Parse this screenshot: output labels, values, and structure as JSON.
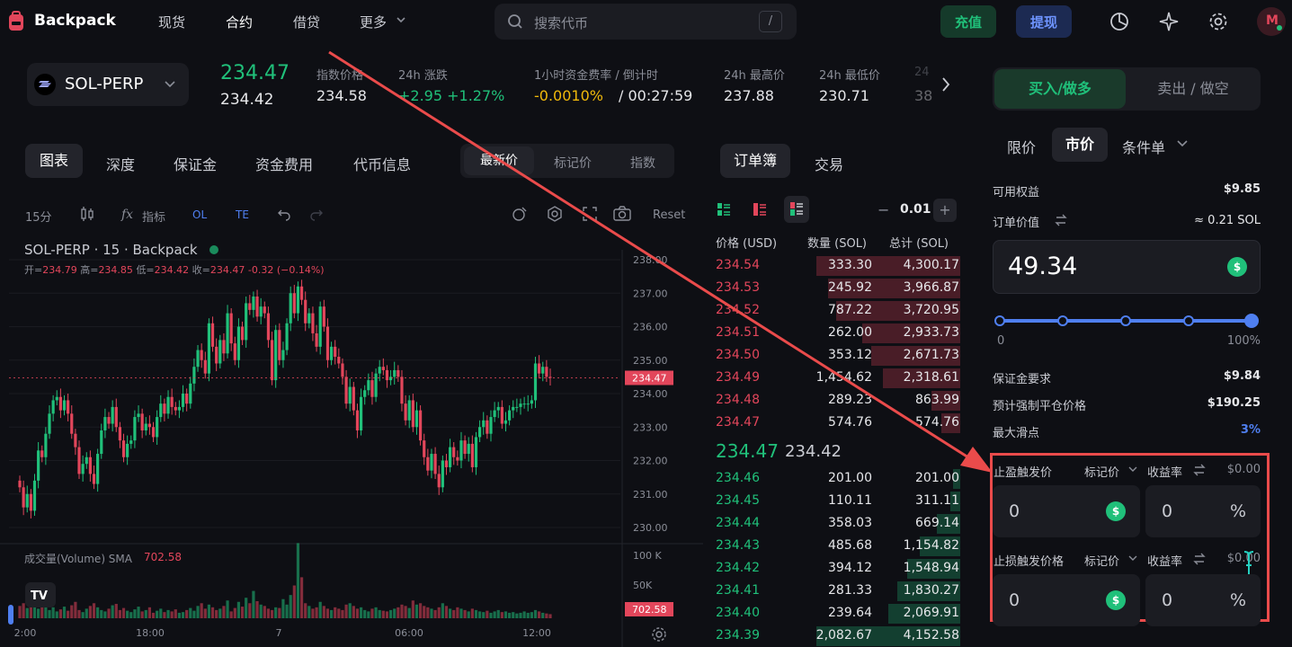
{
  "nav": {
    "brand": "Backpack",
    "links": [
      "现货",
      "合约",
      "借贷",
      "更多"
    ],
    "search_placeholder": "搜索代币",
    "search_shortcut": "/",
    "deposit": "充值",
    "withdraw": "提现",
    "avatar_letter": "M"
  },
  "ticker": {
    "symbol": "SOL-PERP",
    "last_price": "234.47",
    "mark_price": "234.42",
    "index_label": "指数价格",
    "index_value": "234.58",
    "change_label": "24h 涨跌",
    "change_value": "+2.95 +1.27%",
    "funding_label": "1小时资金费率 / 倒计时",
    "funding_rate": "-0.0010%",
    "funding_countdown": "/ 00:27:59",
    "high_label": "24h 最高价",
    "high_value": "237.88",
    "low_label": "24h 最低价",
    "low_value": "230.71",
    "cut_label": "24",
    "cut_value": "38"
  },
  "chart_tabs": [
    "图表",
    "深度",
    "保证金",
    "资金费用",
    "代币信息"
  ],
  "price_tabs": [
    "最新价",
    "标记价",
    "指数"
  ],
  "toolbar": {
    "interval": "15分",
    "indicators": "指标",
    "ol": "OL",
    "te": "TE",
    "reset": "Reset"
  },
  "chart_info": {
    "title": "SOL-PERP · 15 · Backpack",
    "open_label": "开=",
    "open": "234.79",
    "high_label": "高=",
    "high": "234.85",
    "low_label": "低=",
    "low": "234.42",
    "close_label": "收=",
    "close": "234.47",
    "change": "-0.32 (−0.14%)",
    "volume_label": "成交量(Volume) SMA",
    "volume_value": "702.58"
  },
  "chart_data": {
    "type": "candlestick",
    "y_ticks": [
      "238.00",
      "237.00",
      "236.00",
      "235.00",
      "234.00",
      "233.00",
      "232.00",
      "231.00",
      "230.00"
    ],
    "ylim": [
      229.6,
      238.2
    ],
    "price_tag": "234.47",
    "x_ticks": [
      "2:00",
      "18:00",
      "7",
      "06:00",
      "12:00"
    ],
    "volume_ticks": [
      "100 K",
      "50K"
    ],
    "volume_tag": "702.58",
    "closes": [
      231.2,
      230.6,
      231.0,
      230.5,
      231.4,
      232.3,
      232.1,
      232.8,
      233.4,
      233.8,
      233.9,
      233.5,
      233.8,
      233.4,
      232.8,
      232.4,
      231.6,
      231.9,
      232.1,
      231.6,
      231.3,
      232.2,
      232.9,
      233.3,
      233.1,
      233.6,
      233.0,
      232.6,
      232.1,
      232.5,
      232.6,
      233.3,
      233.4,
      232.9,
      233.1,
      233.0,
      232.7,
      233.3,
      233.7,
      233.4,
      233.9,
      233.6,
      233.5,
      233.6,
      234.0,
      233.7,
      234.3,
      234.8,
      235.3,
      235.0,
      234.6,
      236.1,
      235.4,
      234.9,
      235.6,
      235.2,
      236.4,
      235.5,
      235.0,
      236.0,
      235.6,
      236.7,
      236.5,
      236.9,
      236.3,
      236.6,
      236.4,
      235.6,
      234.4,
      235.9,
      235.0,
      235.3,
      236.1,
      237.0,
      236.4,
      237.2,
      236.8,
      236.1,
      236.4,
      235.8,
      235.4,
      236.6,
      236.0,
      235.0,
      235.4,
      235.1,
      234.9,
      234.5,
      233.7,
      234.2,
      233.5,
      232.9,
      233.9,
      234.1,
      234.4,
      233.9,
      234.6,
      234.8,
      234.7,
      234.4,
      234.5,
      234.7,
      234.5,
      233.7,
      233.2,
      233.8,
      233.0,
      233.5,
      232.6,
      232.1,
      231.7,
      232.2,
      231.6,
      231.2,
      232.0,
      231.8,
      232.4,
      232.1,
      232.0,
      232.6,
      232.2,
      232.5,
      231.8,
      232.7,
      233.0,
      233.2,
      232.8,
      233.3,
      233.5,
      233.6,
      233.1,
      233.2,
      233.5,
      233.6,
      233.6,
      233.7,
      233.7,
      233.7,
      233.8,
      234.9,
      234.6,
      234.8,
      234.5,
      234.47
    ],
    "volumes_k": [
      18,
      22,
      15,
      25,
      30,
      14,
      20,
      28,
      12,
      16,
      10,
      13,
      17,
      11,
      19,
      24,
      12,
      9,
      14,
      18,
      22,
      16,
      12,
      10,
      14,
      19,
      21,
      12,
      15,
      11,
      9,
      13,
      17,
      10,
      12,
      16,
      8,
      11,
      14,
      9,
      12,
      10,
      13,
      8,
      9,
      12,
      15,
      11,
      18,
      22,
      14,
      20,
      16,
      12,
      14,
      18,
      26,
      10,
      15,
      24,
      17,
      30,
      22,
      40,
      25,
      20,
      18,
      14,
      12,
      16,
      15,
      28,
      20,
      34,
      48,
      110,
      60,
      22,
      18,
      14,
      16,
      24,
      18,
      14,
      12,
      16,
      14,
      12,
      20,
      22,
      18,
      14,
      16,
      12,
      10,
      14,
      16,
      12,
      11,
      10,
      12,
      14,
      16,
      20,
      18,
      15,
      26,
      20,
      22,
      18,
      16,
      14,
      12,
      16,
      22,
      18,
      14,
      12,
      16,
      14,
      12,
      10,
      14,
      12,
      10,
      9,
      11,
      8,
      10,
      12,
      9,
      10,
      8,
      9,
      7,
      8,
      10,
      8,
      9,
      12,
      10,
      8,
      7,
      6
    ]
  },
  "orderbook": {
    "tabs": [
      "订单簿",
      "交易"
    ],
    "step": "0.01",
    "minus": "−",
    "plus": "+",
    "headers": [
      "价格 (USD)",
      "数量 (SOL)",
      "总计 (SOL)"
    ],
    "asks": [
      {
        "price": "234.54",
        "qty": "333.30",
        "total": "4,300.17",
        "depth": 1.0
      },
      {
        "price": "234.53",
        "qty": "245.92",
        "total": "3,966.87",
        "depth": 0.92
      },
      {
        "price": "234.52",
        "qty": "787.22",
        "total": "3,720.95",
        "depth": 0.86
      },
      {
        "price": "234.51",
        "qty": "262.00",
        "total": "2,933.73",
        "depth": 0.68
      },
      {
        "price": "234.50",
        "qty": "353.12",
        "total": "2,671.73",
        "depth": 0.62
      },
      {
        "price": "234.49",
        "qty": "1,454.62",
        "total": "2,318.61",
        "depth": 0.54
      },
      {
        "price": "234.48",
        "qty": "289.23",
        "total": "863.99",
        "depth": 0.2
      },
      {
        "price": "234.47",
        "qty": "574.76",
        "total": "574.76",
        "depth": 0.13
      }
    ],
    "mid_last": "234.47",
    "mid_mark": "234.42",
    "bids": [
      {
        "price": "234.46",
        "qty": "201.00",
        "total": "201.00",
        "depth": 0.05
      },
      {
        "price": "234.45",
        "qty": "110.11",
        "total": "311.11",
        "depth": 0.07
      },
      {
        "price": "234.44",
        "qty": "358.03",
        "total": "669.14",
        "depth": 0.16
      },
      {
        "price": "234.43",
        "qty": "485.68",
        "total": "1,154.82",
        "depth": 0.28
      },
      {
        "price": "234.42",
        "qty": "394.12",
        "total": "1,548.94",
        "depth": 0.37
      },
      {
        "price": "234.41",
        "qty": "281.33",
        "total": "1,830.27",
        "depth": 0.44
      },
      {
        "price": "234.40",
        "qty": "239.64",
        "total": "2,069.91",
        "depth": 0.5
      },
      {
        "price": "234.39",
        "qty": "2,082.67",
        "total": "4,152.58",
        "depth": 1.0
      }
    ]
  },
  "order": {
    "buy_tab": "买入/做多",
    "sell_tab": "卖出 / 做空",
    "types": [
      "限价",
      "市价",
      "条件单"
    ],
    "equity_label": "可用权益",
    "equity_value": "$9.85",
    "order_value_label": "订单价值",
    "order_value_conv": "≈ 0.21 SOL",
    "amount": "49.34",
    "slider_min": "0",
    "slider_max": "100%",
    "slider_value_pct": 100,
    "margin_label": "保证金要求",
    "margin_value": "$9.84",
    "liq_label": "预计强制平仓价格",
    "liq_value": "$190.25",
    "slippage_label": "最大滑点",
    "slippage_value": "3%",
    "tp_label": "止盈触发价",
    "tp_ref": "标记价",
    "tp_yield_label": "收益率",
    "tp_amount": "$0.00",
    "tp_price": "0",
    "tp_pct": "0",
    "sl_label": "止损触发价格",
    "sl_ref": "标记价",
    "sl_yield_label": "收益率",
    "sl_amount": "$0.00",
    "sl_price": "0",
    "sl_pct": "0",
    "pct_symbol": "%",
    "dollar_symbol": "$"
  },
  "colors": {
    "green": "#20c07a",
    "red": "#e2465b",
    "annotation": "#ea4b4b",
    "slider": "#4f7ff0"
  }
}
